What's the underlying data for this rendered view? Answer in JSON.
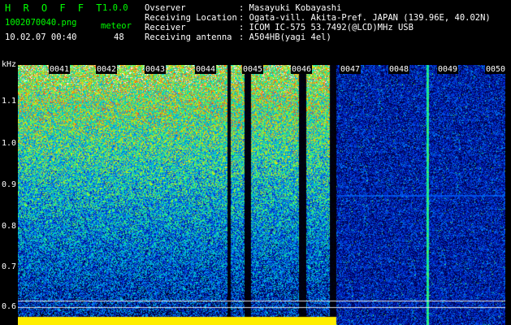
{
  "app": {
    "title": "H R O F F T",
    "version": "1.0.0",
    "filename": "1002070040.png",
    "datetime": "10.02.07 00:40",
    "meteor_label": "meteor",
    "meteor_count": "48"
  },
  "info": {
    "observer_label": "Ovserver",
    "observer_value": ": Masayuki Kobayashi",
    "location_label": "Receiving Location",
    "location_value": ": Ogata-vill. Akita-Pref. JAPAN (139.96E, 40.02N)",
    "receiver_label": "Receiver",
    "receiver_value": ": ICOM IC-575 53.7492(@LCD)MHz USB",
    "antenna_label": "Receiving antenna",
    "antenna_value": ": A504HB(yagi 4el)"
  },
  "axis": {
    "unit": "kHz",
    "yticks": [
      "1.1",
      "1.0",
      "0.9",
      "0.8",
      "0.7",
      "0.6"
    ],
    "xticks": [
      "0041",
      "0042",
      "0043",
      "0044",
      "0045",
      "0046",
      "0047",
      "0048",
      "0049",
      "0050"
    ]
  },
  "colors": {
    "label_green": "#00ff00",
    "background": "#000000"
  }
}
